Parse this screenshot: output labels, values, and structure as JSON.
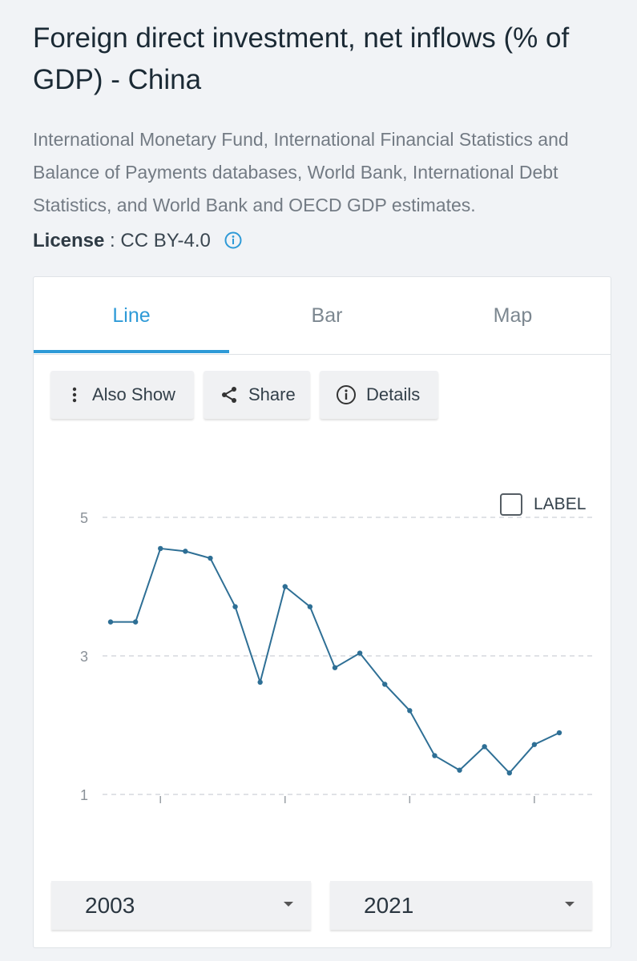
{
  "title": "Foreign direct investment, net inflows (% of GDP) - China",
  "source": "International Monetary Fund, International Financial Statistics and Balance of Payments databases, World Bank, International Debt Statistics, and World Bank and OECD GDP estimates.",
  "license": {
    "label": "License",
    "separator": " : ",
    "value": "CC BY-4.0"
  },
  "tabs": [
    {
      "label": "Line",
      "active": true
    },
    {
      "label": "Bar",
      "active": false
    },
    {
      "label": "Map",
      "active": false
    }
  ],
  "toolbar": {
    "also_show": "Also Show",
    "share": "Share",
    "details": "Details"
  },
  "label_toggle": {
    "text": "LABEL",
    "checked": false
  },
  "range": {
    "start": "2003",
    "end": "2021"
  },
  "colors": {
    "accent": "#2e9ad7",
    "series": "#2e6f95",
    "grid": "#d5d9dd",
    "tick_text": "#8a9198"
  },
  "chart_data": {
    "type": "line",
    "title": "",
    "xlabel": "",
    "ylabel": "",
    "x": [
      2003,
      2004,
      2005,
      2006,
      2007,
      2008,
      2009,
      2010,
      2011,
      2012,
      2013,
      2014,
      2015,
      2016,
      2017,
      2018,
      2019,
      2020,
      2021
    ],
    "series": [
      {
        "values": [
          3.49,
          3.49,
          4.55,
          4.51,
          4.41,
          3.71,
          2.62,
          4.0,
          3.71,
          2.83,
          3.04,
          2.59,
          2.21,
          1.56,
          1.35,
          1.69,
          1.31,
          1.72,
          1.89
        ]
      }
    ],
    "yticks": [
      1,
      3,
      5
    ],
    "xticks": [
      2005,
      2010,
      2015,
      2020
    ],
    "ylim": [
      1,
      5
    ],
    "xlim": [
      2003,
      2021
    ],
    "grid": true,
    "x_tick_labels_shown": false
  }
}
